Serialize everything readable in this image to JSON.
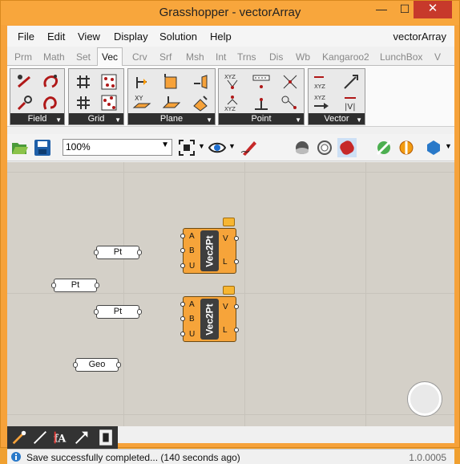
{
  "window": {
    "title": "Grasshopper - vectorArray",
    "close_glyph": "✕",
    "min_glyph": "—",
    "max_glyph": "☐"
  },
  "menu": {
    "items": [
      "File",
      "Edit",
      "View",
      "Display",
      "Solution",
      "Help"
    ],
    "document": "vectorArray"
  },
  "tabs": [
    "Prm",
    "Math",
    "Set",
    "Vec",
    "Crv",
    "Srf",
    "Msh",
    "Int",
    "Trns",
    "Dis",
    "Wb",
    "Kangaroo2",
    "LunchBox",
    "V"
  ],
  "active_tab": "Vec",
  "ribbon": {
    "groups": [
      {
        "label": "Field"
      },
      {
        "label": "Grid"
      },
      {
        "label": "Plane"
      },
      {
        "label": "Point"
      },
      {
        "label": "Vector"
      }
    ]
  },
  "canvas_toolbar": {
    "zoom": "100%"
  },
  "canvas": {
    "params": [
      "Pt",
      "Pt",
      "Pt",
      "Geo"
    ],
    "components": [
      {
        "nickname": "Vec2Pt",
        "inputs": [
          "A",
          "B",
          "U"
        ],
        "outputs": [
          "V",
          "L"
        ]
      },
      {
        "nickname": "Vec2Pt",
        "inputs": [
          "A",
          "B",
          "U"
        ],
        "outputs": [
          "V",
          "L"
        ]
      }
    ]
  },
  "status": {
    "message": "Save successfully completed... (140 seconds ago)",
    "version": "1.0.0005"
  },
  "colors": {
    "accent": "#f6a23a",
    "component": "#f6a43a",
    "close": "#c7392b"
  }
}
